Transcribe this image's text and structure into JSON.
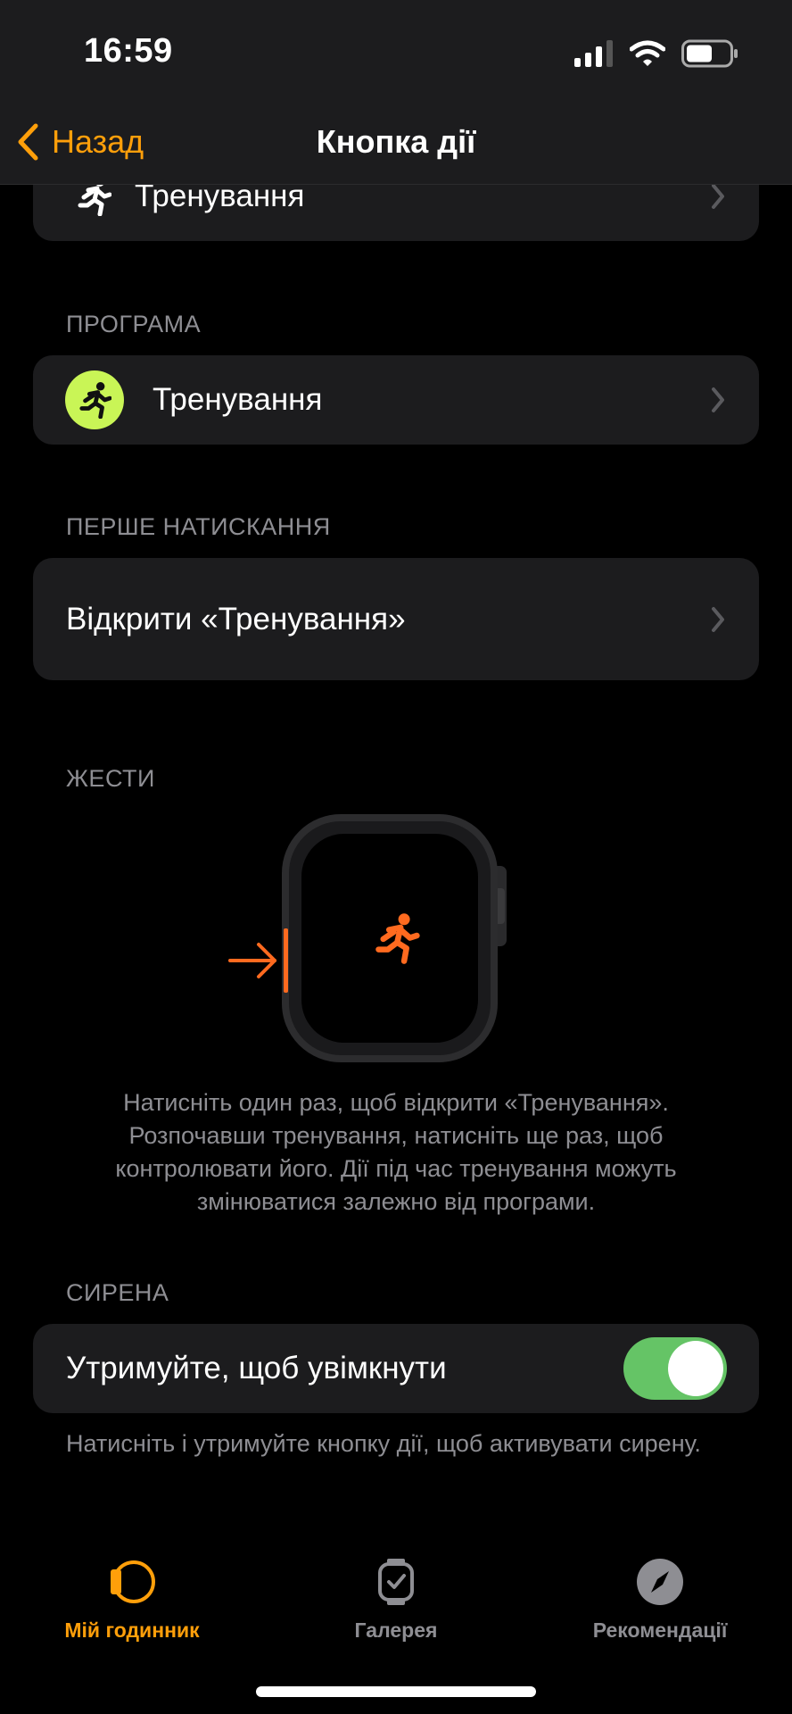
{
  "status_bar": {
    "time": "16:59"
  },
  "nav": {
    "back_label": "Назад",
    "title": "Кнопка дії"
  },
  "top_item": {
    "label": "Тренування"
  },
  "program": {
    "header": "ПРОГРАМА",
    "app_name": "Тренування"
  },
  "first_press": {
    "header": "ПЕРШЕ НАТИСКАННЯ",
    "value": "Відкрити «Тренування»"
  },
  "gestures": {
    "header": "ЖЕСТИ",
    "description": "Натисніть один раз, щоб відкрити «Тренування». Розпочавши тренування, натисніть ще раз, щоб контролювати його. Дії під час тренування можуть змінюватися залежно від програми."
  },
  "siren": {
    "header": "СИРЕНА",
    "toggle_label": "Утримуйте, щоб увімкнути",
    "toggle_on": true,
    "footer": "Натисніть і утримуйте кнопку дії, щоб активувати сирену."
  },
  "tab_bar": {
    "tabs": [
      {
        "label": "Мій годинник",
        "icon": "watch-face-icon",
        "active": true
      },
      {
        "label": "Галерея",
        "icon": "watch-gallery-icon",
        "active": false
      },
      {
        "label": "Рекомендації",
        "icon": "compass-icon",
        "active": false
      }
    ]
  },
  "colors": {
    "accent": "#ff9f0a",
    "cell_background": "#1c1c1e",
    "toggle_on": "#65c466",
    "workout_icon": "#c9f556",
    "secondary_text": "#8e8e93",
    "gesture_orange": "#ff6a1f"
  }
}
